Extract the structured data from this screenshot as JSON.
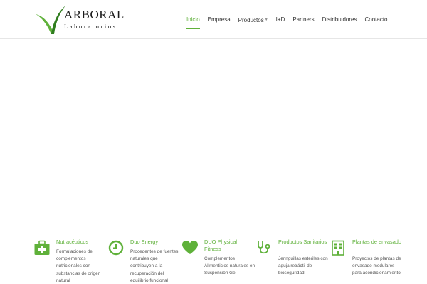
{
  "brand": {
    "name": "ARBORAL",
    "subtitle": "Laboratorios",
    "accent_color": "#5fb13a"
  },
  "nav": {
    "items": [
      {
        "label": "Inicio",
        "active": true
      },
      {
        "label": "Empresa"
      },
      {
        "label": "Productos",
        "has_dropdown": true
      },
      {
        "label": "I+D"
      },
      {
        "label": "Partners"
      },
      {
        "label": "Distribuidores"
      },
      {
        "label": "Contacto"
      }
    ]
  },
  "features": [
    {
      "icon": "first-aid-kit-icon",
      "title": "Nutracéuticos",
      "desc": "Formulaciones de complementos nutricionales con substancias de origen natural"
    },
    {
      "icon": "clock-icon",
      "title": "Duo Energy",
      "desc": "Procedentes de fuentes naturales que contribuyen a la recuperación del equilibrio funcional"
    },
    {
      "icon": "heart-icon",
      "title": "DUO Physical Fitness",
      "desc": "Complementos Alimenticios naturales en Suspensión Gel"
    },
    {
      "icon": "stethoscope-icon",
      "title": "Productos Sanitarios",
      "desc": "Jeringuillas estériles con aguja retráctil de bioseguridad."
    },
    {
      "icon": "building-icon",
      "title": "Plantas de envasado",
      "desc": "Proyectos de plantas de envasado modulares para acondicionamiento"
    }
  ]
}
